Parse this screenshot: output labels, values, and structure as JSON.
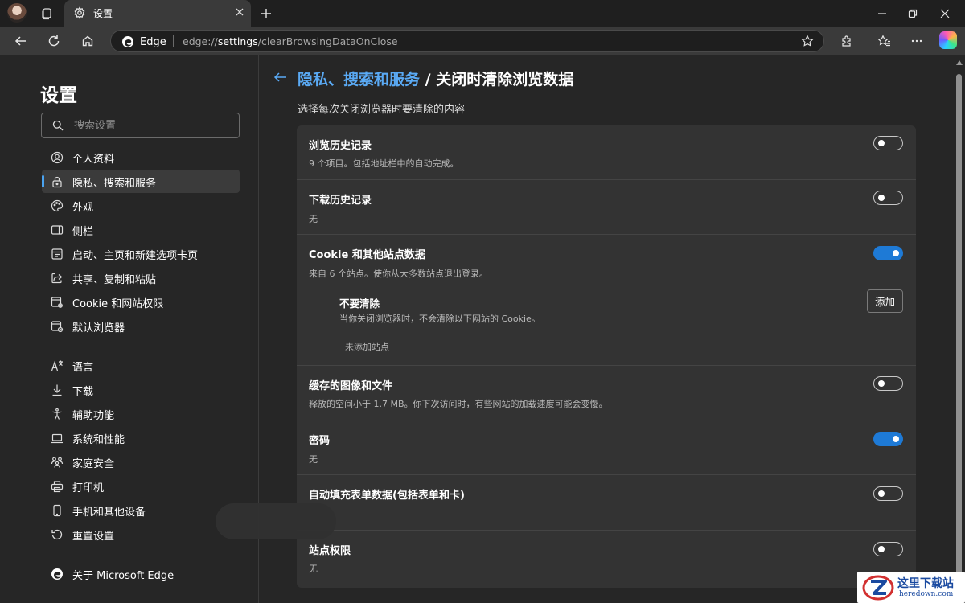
{
  "tab": {
    "title": "设置"
  },
  "address": {
    "site_label": "Edge",
    "url_scheme": "edge://",
    "url_host": "settings",
    "url_path": "/clearBrowsingDataOnClose"
  },
  "sidebar": {
    "title": "设置",
    "search_placeholder": "搜索设置",
    "items": [
      {
        "label": "个人资料",
        "icon": "profile-icon"
      },
      {
        "label": "隐私、搜索和服务",
        "icon": "lock-icon",
        "selected": true
      },
      {
        "label": "外观",
        "icon": "palette-icon"
      },
      {
        "label": "侧栏",
        "icon": "sidebar-icon"
      },
      {
        "label": "启动、主页和新建选项卡页",
        "icon": "home-window-icon"
      },
      {
        "label": "共享、复制和粘贴",
        "icon": "share-icon"
      },
      {
        "label": "Cookie 和网站权限",
        "icon": "site-permissions-icon"
      },
      {
        "label": "默认浏览器",
        "icon": "default-browser-icon"
      },
      {
        "label": "语言",
        "icon": "language-icon"
      },
      {
        "label": "下载",
        "icon": "download-icon"
      },
      {
        "label": "辅助功能",
        "icon": "accessibility-icon"
      },
      {
        "label": "系统和性能",
        "icon": "laptop-icon"
      },
      {
        "label": "家庭安全",
        "icon": "family-icon"
      },
      {
        "label": "打印机",
        "icon": "printer-icon"
      },
      {
        "label": "手机和其他设备",
        "icon": "phone-icon"
      },
      {
        "label": "重置设置",
        "icon": "reset-icon"
      },
      {
        "label": "关于 Microsoft Edge",
        "icon": "edge-logo-icon"
      }
    ]
  },
  "main": {
    "breadcrumb_parent": "隐私、搜索和服务",
    "breadcrumb_sep": " / ",
    "breadcrumb_current": "关闭时清除浏览数据",
    "subtitle": "选择每次关闭浏览器时要清除的内容",
    "rows": [
      {
        "title": "浏览历史记录",
        "desc": "9 个项目。包括地址栏中的自动完成。",
        "enabled": false
      },
      {
        "title": "下载历史记录",
        "desc": "无",
        "enabled": false
      },
      {
        "title": "Cookie 和其他站点数据",
        "desc": "来自 6 个站点。使你从大多数站点退出登录。",
        "enabled": true
      },
      {
        "title": "缓存的图像和文件",
        "desc": "释放的空间小于 1.7 MB。你下次访问时，有些网站的加载速度可能会变慢。",
        "enabled": false
      },
      {
        "title": "密码",
        "desc": "无",
        "enabled": true
      },
      {
        "title": "自动填充表单数据(包括表单和卡)",
        "desc": "",
        "enabled": false
      },
      {
        "title": "站点权限",
        "desc": "无",
        "enabled": false
      }
    ],
    "dont_clear": {
      "title": "不要清除",
      "desc": "当你关闭浏览器时，不会清除以下网站的 Cookie。",
      "add_label": "添加",
      "empty_label": "未添加站点"
    }
  },
  "watermark": {
    "cn": "这里下载站",
    "en": "heredown.com"
  },
  "colors": {
    "accent": "#1e7ad6",
    "link": "#5aaaf5",
    "background": "#262626",
    "card": "#333333"
  }
}
